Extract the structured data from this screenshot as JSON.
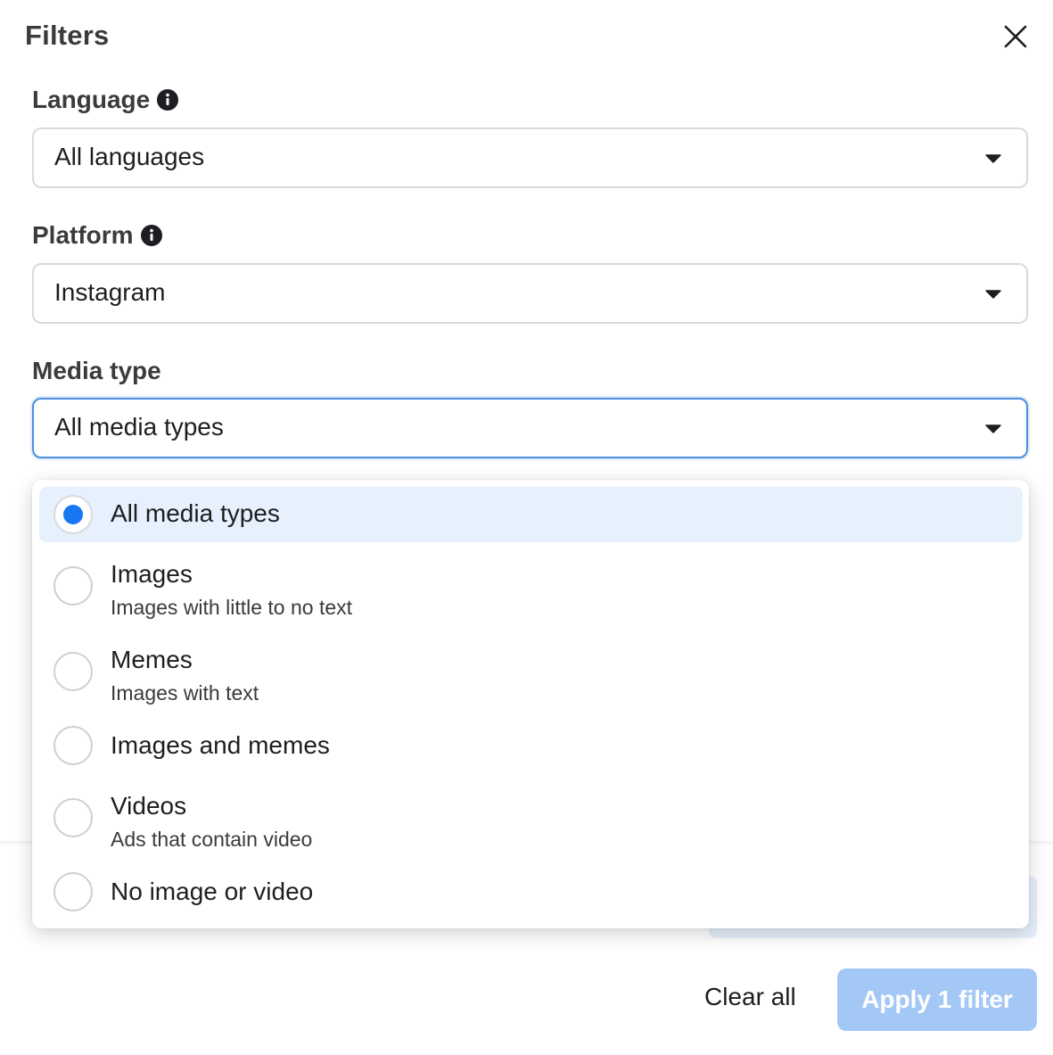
{
  "dialog": {
    "title": "Filters",
    "close_icon": "close-icon"
  },
  "language": {
    "label": "Language",
    "info_icon": "info-icon",
    "value": "All languages"
  },
  "platform": {
    "label": "Platform",
    "info_icon": "info-icon",
    "value": "Instagram"
  },
  "media_type": {
    "label": "Media type",
    "value": "All media types",
    "options": [
      {
        "label": "All media types",
        "description": "",
        "selected": true
      },
      {
        "label": "Images",
        "description": "Images with little to no text",
        "selected": false
      },
      {
        "label": "Memes",
        "description": "Images with text",
        "selected": false
      },
      {
        "label": "Images and memes",
        "description": "",
        "selected": false
      },
      {
        "label": "Videos",
        "description": "Ads that contain video",
        "selected": false
      },
      {
        "label": "No image or video",
        "description": "",
        "selected": false
      }
    ]
  },
  "footer": {
    "clear_label": "Clear all",
    "apply_label": "Apply 1 filter"
  },
  "colors": {
    "accent": "#1877f2",
    "apply_disabled_bg": "#a3c8f5",
    "selected_option_bg": "#e7f0fd",
    "focus_border": "#4a90e2"
  }
}
